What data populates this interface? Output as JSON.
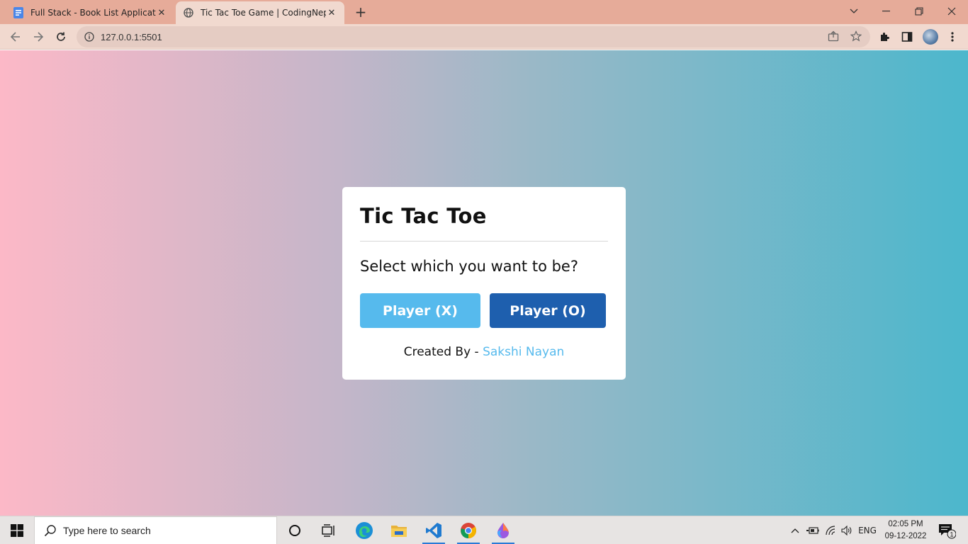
{
  "browser": {
    "tabs": [
      {
        "title": "Full Stack - Book List Application",
        "favicon": "docs-icon",
        "active": false
      },
      {
        "title": "Tic Tac Toe Game | CodingNepal",
        "favicon": "globe-icon",
        "active": true
      }
    ],
    "new_tab_icon": "+",
    "url": "127.0.0.1:5501"
  },
  "game": {
    "title": "Tic Tac Toe",
    "prompt": "Select which you want to be?",
    "player_x_label": "Player (X)",
    "player_o_label": "Player (O)",
    "credit_prefix": "Created By -",
    "credit_author": "Sakshi Nayan"
  },
  "taskbar": {
    "search_placeholder": "Type here to search",
    "language": "ENG",
    "time": "02:05 PM",
    "date": "09-12-2022",
    "notification_count": "1"
  },
  "colors": {
    "player_x_button": "#56baed",
    "player_o_button": "#1e5fae",
    "author_link": "#56baed",
    "gradient_start": "#fcb8c7",
    "gradient_end": "#4cb7cc"
  }
}
